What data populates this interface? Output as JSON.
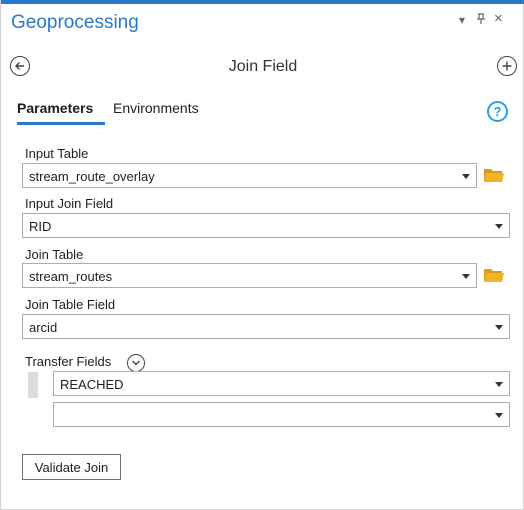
{
  "pane": {
    "title": "Geoprocessing",
    "controls": {
      "dropdown": "▾",
      "pin": "⊥",
      "close": "×"
    }
  },
  "tool": {
    "title": "Join Field"
  },
  "tabs": [
    {
      "label": "Parameters",
      "active": true
    },
    {
      "label": "Environments",
      "active": false
    }
  ],
  "help": {
    "glyph": "?"
  },
  "params": {
    "input_table": {
      "label": "Input Table",
      "value": "stream_route_overlay"
    },
    "input_join_field": {
      "label": "Input Join Field",
      "value": "RID"
    },
    "join_table": {
      "label": "Join Table",
      "value": "stream_routes"
    },
    "join_table_field": {
      "label": "Join Table Field",
      "value": "arcid"
    },
    "transfer_fields": {
      "label": "Transfer Fields",
      "values": [
        "REACHED",
        ""
      ]
    }
  },
  "buttons": {
    "validate_join": "Validate Join"
  },
  "colors": {
    "accent": "#2b78c6",
    "help": "#2b9fdc",
    "folder": "#f0b429"
  }
}
